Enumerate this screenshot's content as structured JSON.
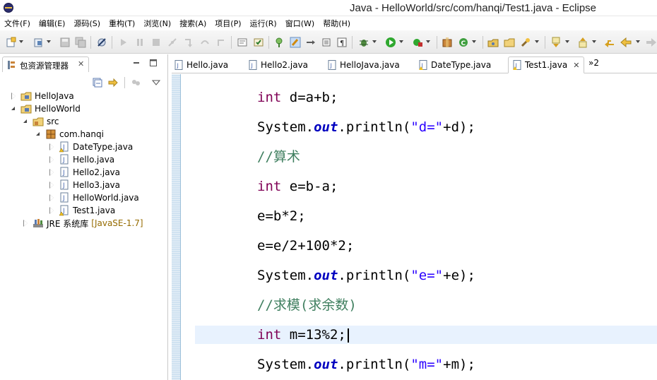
{
  "window": {
    "title": "Java - HelloWorld/src/com/hanqi/Test1.java - Eclipse"
  },
  "menu": {
    "items": [
      "文件(F)",
      "编辑(E)",
      "源码(S)",
      "重构(T)",
      "浏览(N)",
      "搜索(A)",
      "项目(P)",
      "运行(R)",
      "窗口(W)",
      "帮助(H)"
    ]
  },
  "package_explorer": {
    "title": "包资源管理器",
    "tree": [
      {
        "label": "HelloJava",
        "expanded": false,
        "kind": "project"
      },
      {
        "label": "HelloWorld",
        "expanded": true,
        "kind": "project"
      },
      {
        "label": "src",
        "expanded": true,
        "kind": "source-folder"
      },
      {
        "label": "com.hanqi",
        "expanded": true,
        "kind": "package"
      },
      {
        "label": "DateType.java",
        "expanded": false,
        "kind": "java-file"
      },
      {
        "label": "Hello.java",
        "expanded": false,
        "kind": "java-file"
      },
      {
        "label": "Hello2.java",
        "expanded": false,
        "kind": "java-file"
      },
      {
        "label": "Hello3.java",
        "expanded": false,
        "kind": "java-file"
      },
      {
        "label": "HelloWorld.java",
        "expanded": false,
        "kind": "java-file"
      },
      {
        "label": "Test1.java",
        "expanded": false,
        "kind": "java-file"
      },
      {
        "label": "JRE 系统库",
        "suffix": "[JavaSE-1.7]",
        "expanded": false,
        "kind": "library"
      }
    ]
  },
  "editor": {
    "tabs": [
      {
        "label": "Hello.java",
        "active": false
      },
      {
        "label": "Hello2.java",
        "active": false
      },
      {
        "label": "HelloJava.java",
        "active": false
      },
      {
        "label": "DateType.java",
        "active": false
      },
      {
        "label": "Test1.java",
        "active": true
      }
    ],
    "overflow_label": "»2",
    "code": {
      "l1_kw": "int",
      "l1_rest": " d=a+b;",
      "l2_a": "System.",
      "l2_field": "out",
      "l2_b": ".println(",
      "l2_str": "\"d=\"",
      "l2_c": "+d);",
      "l3_comment": "//算术",
      "l4_kw": "int",
      "l4_rest": " e=b-a;",
      "l5": "e=b*2;",
      "l6": "e=e/2+100*2;",
      "l7_a": "System.",
      "l7_field": "out",
      "l7_b": ".println(",
      "l7_str": "\"e=\"",
      "l7_c": "+e);",
      "l8_comment": "//求模(求余数)",
      "l9_kw": "int",
      "l9_rest": " m=13%2;",
      "l10_a": "System.",
      "l10_field": "out",
      "l10_b": ".println(",
      "l10_str": "\"m=\"",
      "l10_c": "+m);"
    }
  },
  "colors": {
    "keyword": "#7f0055",
    "field": "#0000c0",
    "string": "#2a00ff",
    "comment": "#3f7f5f",
    "current_line": "#e8f2fe",
    "library_suffix": "#956b00"
  }
}
